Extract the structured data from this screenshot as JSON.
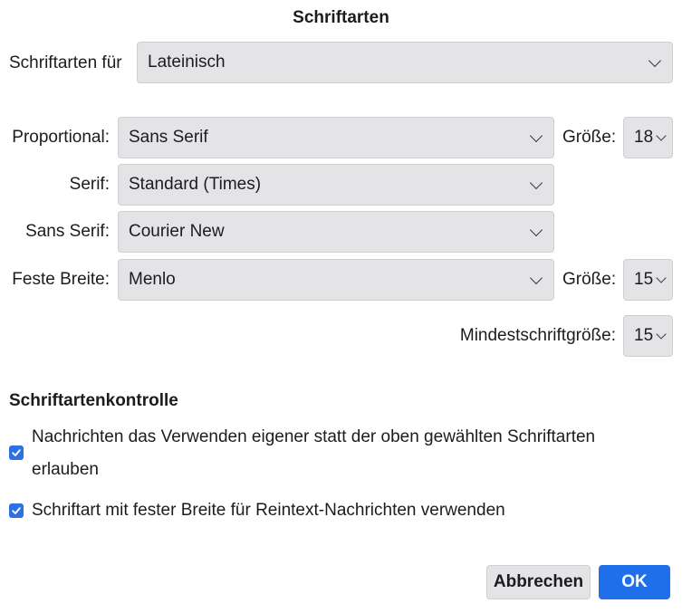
{
  "dialog": {
    "title": "Schriftarten"
  },
  "script_row": {
    "label": "Schriftarten für",
    "value": "Lateinisch"
  },
  "proportional": {
    "label": "Proportional:",
    "value": "Sans Serif",
    "size_label": "Größe:",
    "size_value": "18"
  },
  "serif": {
    "label": "Serif:",
    "value": "Standard (Times)"
  },
  "sans_serif": {
    "label": "Sans Serif:",
    "value": "Courier New"
  },
  "monospace": {
    "label": "Feste Breite:",
    "value": "Menlo",
    "size_label": "Größe:",
    "size_value": "15"
  },
  "minimum": {
    "label": "Mindestschriftgröße:",
    "value": "15"
  },
  "font_control": {
    "heading": "Schriftartenkontrolle",
    "options": [
      {
        "label": "Nachrichten das Verwenden eigener statt der oben gewählten Schriftarten erlauben",
        "checked": true
      },
      {
        "label": "Schriftart mit fester Breite für Reintext-Nachrichten verwenden",
        "checked": true
      }
    ]
  },
  "buttons": {
    "cancel": "Abbrechen",
    "ok": "OK"
  },
  "colors": {
    "accent": "#1f6feb",
    "control_bg": "#e4e4e6"
  }
}
